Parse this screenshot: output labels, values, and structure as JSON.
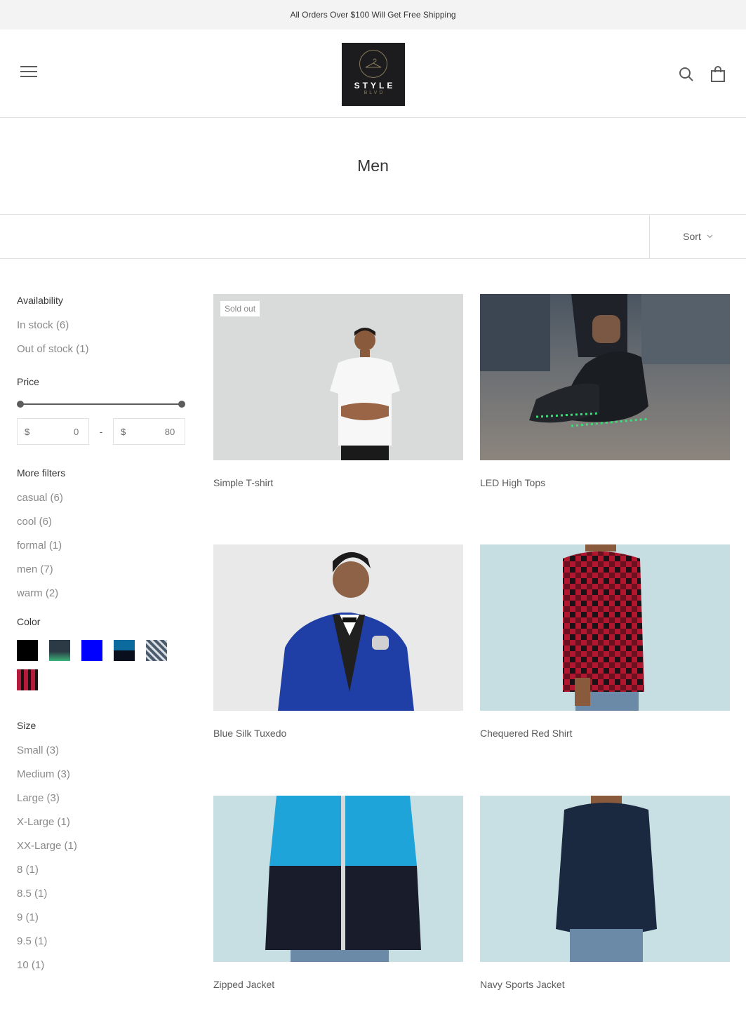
{
  "announcement": {
    "text": "All Orders Over $100 Will Get Free Shipping"
  },
  "header": {
    "logo_word": "STYLE",
    "logo_sub": "BLVD",
    "icons": [
      "hamburger-menu-icon",
      "search-icon",
      "shopping-bag-icon"
    ]
  },
  "page": {
    "title": "Men"
  },
  "toolbar": {
    "sort_label": "Sort"
  },
  "filters": {
    "availability": {
      "title": "Availability",
      "items": [
        {
          "label": "In stock (6)"
        },
        {
          "label": "Out of stock (1)"
        }
      ]
    },
    "price": {
      "title": "Price",
      "currency": "$",
      "min_placeholder": "0",
      "max_placeholder": "80",
      "separator": "-"
    },
    "more_filters": {
      "title": "More filters",
      "items": [
        {
          "label": "casual (6)"
        },
        {
          "label": "cool (6)"
        },
        {
          "label": "formal (1)"
        },
        {
          "label": "men (7)"
        },
        {
          "label": "warm (2)"
        }
      ]
    },
    "color": {
      "title": "Color",
      "swatches": [
        {
          "color": "#000000"
        },
        {
          "color": "#2b3a45"
        },
        {
          "color": "#0000ff"
        },
        {
          "color": "#0b6a9e"
        },
        {
          "color": "#4a5b6e"
        },
        {
          "color": "#b51a3a"
        }
      ]
    },
    "size": {
      "title": "Size",
      "items": [
        {
          "label": "Small (3)"
        },
        {
          "label": "Medium (3)"
        },
        {
          "label": "Large (3)"
        },
        {
          "label": "X-Large (1)"
        },
        {
          "label": "XX-Large (1)"
        },
        {
          "label": "8 (1)"
        },
        {
          "label": "8.5 (1)"
        },
        {
          "label": "9 (1)"
        },
        {
          "label": "9.5 (1)"
        },
        {
          "label": "10 (1)"
        }
      ]
    }
  },
  "products": [
    {
      "name": "Simple T-shirt",
      "badge": "Sold out"
    },
    {
      "name": "LED High Tops"
    },
    {
      "name": "Blue Silk Tuxedo"
    },
    {
      "name": "Chequered Red Shirt"
    },
    {
      "name": "Zipped Jacket"
    },
    {
      "name": "Navy Sports Jacket"
    }
  ]
}
